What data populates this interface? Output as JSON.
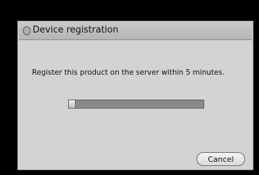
{
  "dialog": {
    "title": "Device registration",
    "message": "Register this product on the server within 5 minutes.",
    "progress": 0.05,
    "cancel_label": "Cancel"
  },
  "icons": {
    "title": "title-circle-icon"
  }
}
